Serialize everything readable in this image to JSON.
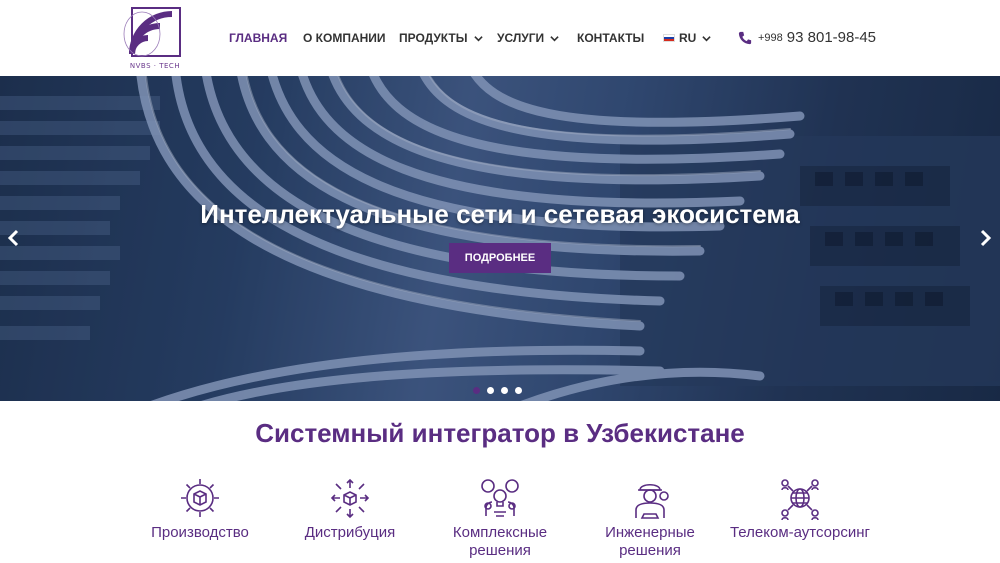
{
  "brand": {
    "logo_text": "NVBS · TECH",
    "accent": "#5a2d82"
  },
  "nav": {
    "items": [
      {
        "label": "ГЛАВНАЯ",
        "active": true
      },
      {
        "label": "О КОМПАНИИ"
      },
      {
        "label": "ПРОДУКТЫ",
        "dropdown": true
      },
      {
        "label": "УСЛУГИ",
        "dropdown": true
      },
      {
        "label": "КОНТАКТЫ"
      }
    ],
    "language": "RU"
  },
  "phone": {
    "prefix": "+998",
    "number": "93 801-98-45"
  },
  "hero": {
    "title": "Интеллектуальные сети и сетевая экосистема",
    "button": "ПОДРОБНЕЕ",
    "prev_icon": "chevron-left-icon",
    "next_icon": "chevron-right-icon",
    "slides": 4,
    "active_slide": 1
  },
  "section": {
    "title": "Системный интегратор в Узбекистане",
    "services": [
      {
        "label": "Производство",
        "icon": "gear-cube-icon"
      },
      {
        "label": "Дистрибуция",
        "icon": "distribution-icon"
      },
      {
        "label": "Комплексные решения",
        "icon": "ideas-icon"
      },
      {
        "label": "Инженерные решения",
        "icon": "engineer-icon"
      },
      {
        "label": "Телеком-аутсорсинг",
        "icon": "globe-network-icon"
      }
    ]
  }
}
